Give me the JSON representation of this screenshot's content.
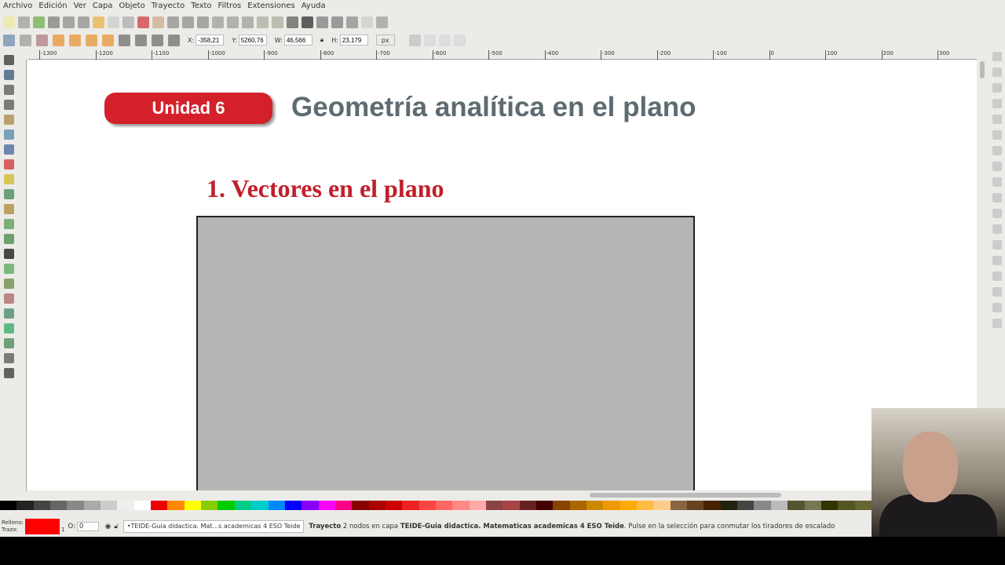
{
  "menu": [
    "Archivo",
    "Edición",
    "Ver",
    "Capa",
    "Objeto",
    "Trayecto",
    "Texto",
    "Filtros",
    "Extensiones",
    "Ayuda"
  ],
  "toolbar": {
    "x_label": "X:",
    "x": "-358,21",
    "y_label": "Y:",
    "y": "5260,76",
    "w_label": "W:",
    "w": "46,566",
    "h_label": "H:",
    "h": "23,179",
    "unit": "px"
  },
  "ruler": [
    "-1300",
    "-1200",
    "-1100",
    "-1000",
    "-900",
    "-800",
    "-700",
    "-600",
    "-500",
    "-400",
    "-300",
    "-200",
    "-100",
    "0",
    "100",
    "200",
    "300"
  ],
  "document": {
    "badge": "Unidad 6",
    "title": "Geometría analítica en el plano",
    "section": "1. Vectores en el plano"
  },
  "status": {
    "fill_label": "Relleno:",
    "stroke_label": "Trazo:",
    "stroke_width": "1",
    "opacity_label": "O:",
    "opacity": "0",
    "layer": "•TEIDE-Guia didactica. Mat...s academicas 4 ESO Teide",
    "msg_type": "Trayecto",
    "msg_mid": " 2 nodos en capa ",
    "msg_layer": "TEIDE-Guia didactica. Matematicas academicas 4 ESO Teide",
    "msg_tail": ". Pulse en la selección para conmutar los tiradores de escalado"
  },
  "colors": {
    "fill": "#ff0000",
    "badge": "#d4202a",
    "section": "#c0202a"
  }
}
